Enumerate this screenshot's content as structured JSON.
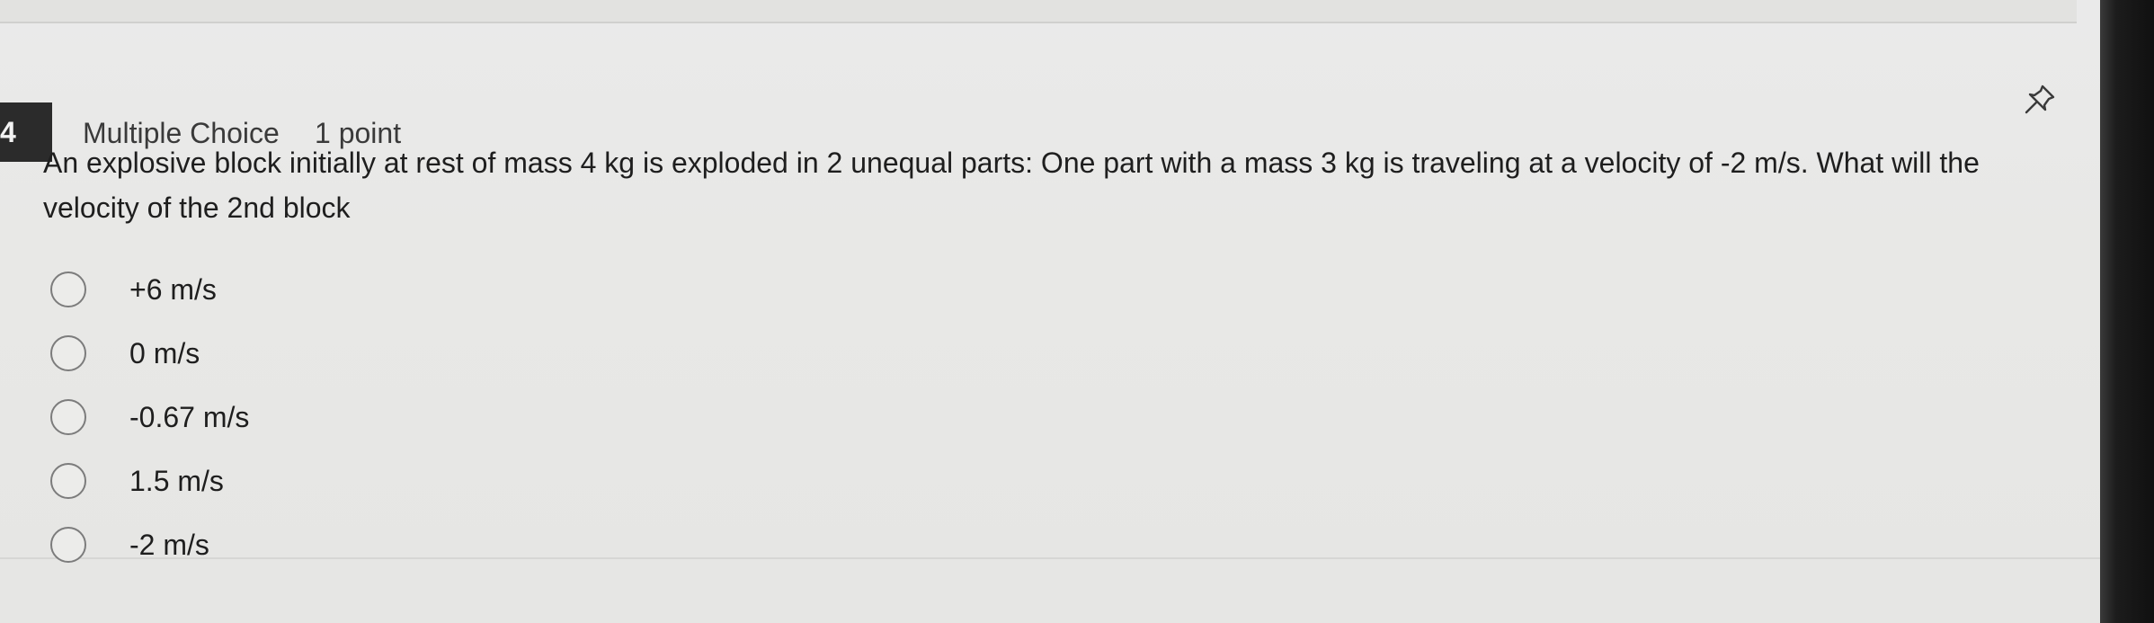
{
  "question": {
    "number": "4",
    "type": "Multiple Choice",
    "points": "1 point",
    "prompt": "An explosive block initially at rest of mass 4 kg is exploded in 2 unequal parts: One part with a mass 3 kg is traveling at a velocity of -2 m/s. What will the velocity of the 2nd block",
    "options": [
      {
        "label": "+6 m/s"
      },
      {
        "label": "0 m/s"
      },
      {
        "label": "-0.67 m/s"
      },
      {
        "label": "1.5 m/s"
      },
      {
        "label": "-2 m/s"
      }
    ]
  },
  "icons": {
    "pin": "pin-icon",
    "radio": "radio-circle"
  },
  "colors": {
    "badge": "#2b2b2b",
    "text": "#1e1e1e",
    "radio_border": "#7c7c7c"
  }
}
